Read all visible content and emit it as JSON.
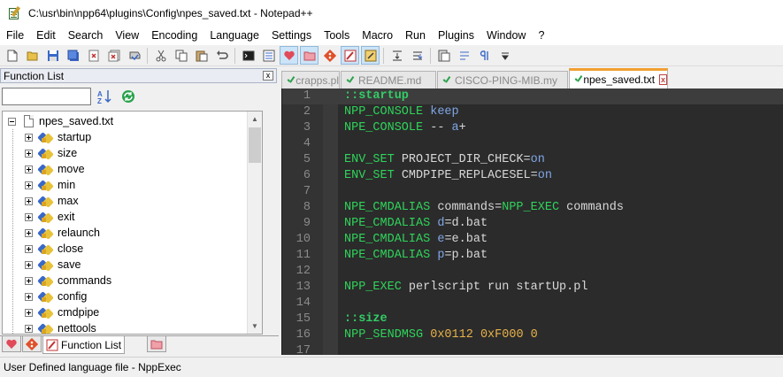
{
  "window": {
    "title": "C:\\usr\\bin\\npp64\\plugins\\Config\\npes_saved.txt - Notepad++"
  },
  "menu": {
    "items": [
      {
        "label": "File"
      },
      {
        "label": "Edit"
      },
      {
        "label": "Search"
      },
      {
        "label": "View"
      },
      {
        "label": "Encoding"
      },
      {
        "label": "Language"
      },
      {
        "label": "Settings"
      },
      {
        "label": "Tools"
      },
      {
        "label": "Macro"
      },
      {
        "label": "Run"
      },
      {
        "label": "Plugins"
      },
      {
        "label": "Window"
      },
      {
        "label": "?"
      }
    ]
  },
  "toolbar": {
    "icons": [
      "new-file-icon",
      "open-file-icon",
      "save-icon",
      "save-all-icon",
      "close-icon",
      "close-all-icon",
      "print-icon",
      "cut-icon",
      "copy-icon",
      "paste-icon",
      "undo-icon",
      "redo-icon",
      "console-icon",
      "function-list-icon",
      "favorites-icon",
      "folder-icon",
      "git-icon",
      "npp-exec-icon",
      "script-icon",
      "indent-icon",
      "wrap-icon",
      "new-doc-icon",
      "word-wrap-icon",
      "show-all-chars-icon",
      "dropdown-icon"
    ]
  },
  "function_list": {
    "title": "Function List",
    "close_label": "x",
    "search_value": "",
    "root": {
      "label": "npes_saved.txt"
    },
    "items": [
      {
        "label": "startup"
      },
      {
        "label": "size"
      },
      {
        "label": "move"
      },
      {
        "label": "min"
      },
      {
        "label": "max"
      },
      {
        "label": "exit"
      },
      {
        "label": "relaunch"
      },
      {
        "label": "close"
      },
      {
        "label": "save"
      },
      {
        "label": "commands"
      },
      {
        "label": "config"
      },
      {
        "label": "cmdpipe"
      },
      {
        "label": "nettools"
      }
    ]
  },
  "panel_tabs": [
    {
      "label": "",
      "icon": "favorites-icon"
    },
    {
      "label": "",
      "icon": "git-icon"
    },
    {
      "label": "Function List",
      "icon": "npp-exec-icon"
    },
    {
      "label": "",
      "icon": "folder-icon"
    }
  ],
  "editor_tabs": [
    {
      "label": "crapps.pl",
      "active": false
    },
    {
      "label": "README.md",
      "active": false
    },
    {
      "label": "CISCO-PING-MIB.my",
      "active": false
    },
    {
      "label": "npes_saved.txt",
      "active": true,
      "close_label": "x"
    }
  ],
  "code_lines": [
    {
      "n": "1",
      "tokens": [
        {
          "t": "::startup",
          "c": "kw-section"
        }
      ]
    },
    {
      "n": "2",
      "tokens": [
        {
          "t": "NPP_CONSOLE",
          "c": "kw-cmd"
        },
        {
          "t": " ",
          "c": "tk-plain"
        },
        {
          "t": "keep",
          "c": "tk-kw"
        }
      ]
    },
    {
      "n": "3",
      "tokens": [
        {
          "t": "NPE_CONSOLE",
          "c": "kw-cmd"
        },
        {
          "t": " -- ",
          "c": "tk-plain"
        },
        {
          "t": "a",
          "c": "tk-kw"
        },
        {
          "t": "+",
          "c": "tk-plain"
        }
      ]
    },
    {
      "n": "4",
      "tokens": []
    },
    {
      "n": "5",
      "tokens": [
        {
          "t": "ENV_SET",
          "c": "kw-cmd"
        },
        {
          "t": " PROJECT_DIR_CHECK=",
          "c": "tk-plain"
        },
        {
          "t": "on",
          "c": "tk-kw"
        }
      ]
    },
    {
      "n": "6",
      "tokens": [
        {
          "t": "ENV_SET",
          "c": "kw-cmd"
        },
        {
          "t": " CMDPIPE_REPLACESEL=",
          "c": "tk-plain"
        },
        {
          "t": "on",
          "c": "tk-kw"
        }
      ]
    },
    {
      "n": "7",
      "tokens": []
    },
    {
      "n": "8",
      "tokens": [
        {
          "t": "NPE_CMDALIAS",
          "c": "kw-cmd"
        },
        {
          "t": " commands=",
          "c": "tk-plain"
        },
        {
          "t": "NPP_EXEC",
          "c": "kw-cmd"
        },
        {
          "t": " commands",
          "c": "tk-plain"
        }
      ]
    },
    {
      "n": "9",
      "tokens": [
        {
          "t": "NPE_CMDALIAS",
          "c": "kw-cmd"
        },
        {
          "t": " ",
          "c": "tk-plain"
        },
        {
          "t": "d",
          "c": "tk-kw"
        },
        {
          "t": "=d.bat",
          "c": "tk-plain"
        }
      ]
    },
    {
      "n": "10",
      "tokens": [
        {
          "t": "NPE_CMDALIAS",
          "c": "kw-cmd"
        },
        {
          "t": " ",
          "c": "tk-plain"
        },
        {
          "t": "e",
          "c": "tk-kw"
        },
        {
          "t": "=e.bat",
          "c": "tk-plain"
        }
      ]
    },
    {
      "n": "11",
      "tokens": [
        {
          "t": "NPE_CMDALIAS",
          "c": "kw-cmd"
        },
        {
          "t": " ",
          "c": "tk-plain"
        },
        {
          "t": "p",
          "c": "tk-kw"
        },
        {
          "t": "=p.bat",
          "c": "tk-plain"
        }
      ]
    },
    {
      "n": "12",
      "tokens": []
    },
    {
      "n": "13",
      "tokens": [
        {
          "t": "NPP_EXEC",
          "c": "kw-cmd"
        },
        {
          "t": " perlscript run startUp.pl",
          "c": "tk-plain"
        }
      ]
    },
    {
      "n": "14",
      "tokens": []
    },
    {
      "n": "15",
      "tokens": [
        {
          "t": "::size",
          "c": "kw-section"
        }
      ]
    },
    {
      "n": "16",
      "tokens": [
        {
          "t": "NPP_SENDMSG",
          "c": "kw-cmd"
        },
        {
          "t": " ",
          "c": "tk-plain"
        },
        {
          "t": "0x0112",
          "c": "tk-num"
        },
        {
          "t": " ",
          "c": "tk-plain"
        },
        {
          "t": "0xF000",
          "c": "tk-num"
        },
        {
          "t": " ",
          "c": "tk-plain"
        },
        {
          "t": "0",
          "c": "tk-num"
        }
      ]
    },
    {
      "n": "17",
      "tokens": []
    }
  ],
  "status": {
    "text": "User Defined language file - NppExec"
  },
  "colors": {
    "accent_tab": "#f0a030",
    "editor_bg": "#2b2b2b",
    "command_green": "#2fd45a",
    "keyword_blue": "#7fa6e6",
    "number_orange": "#e8b24a"
  }
}
